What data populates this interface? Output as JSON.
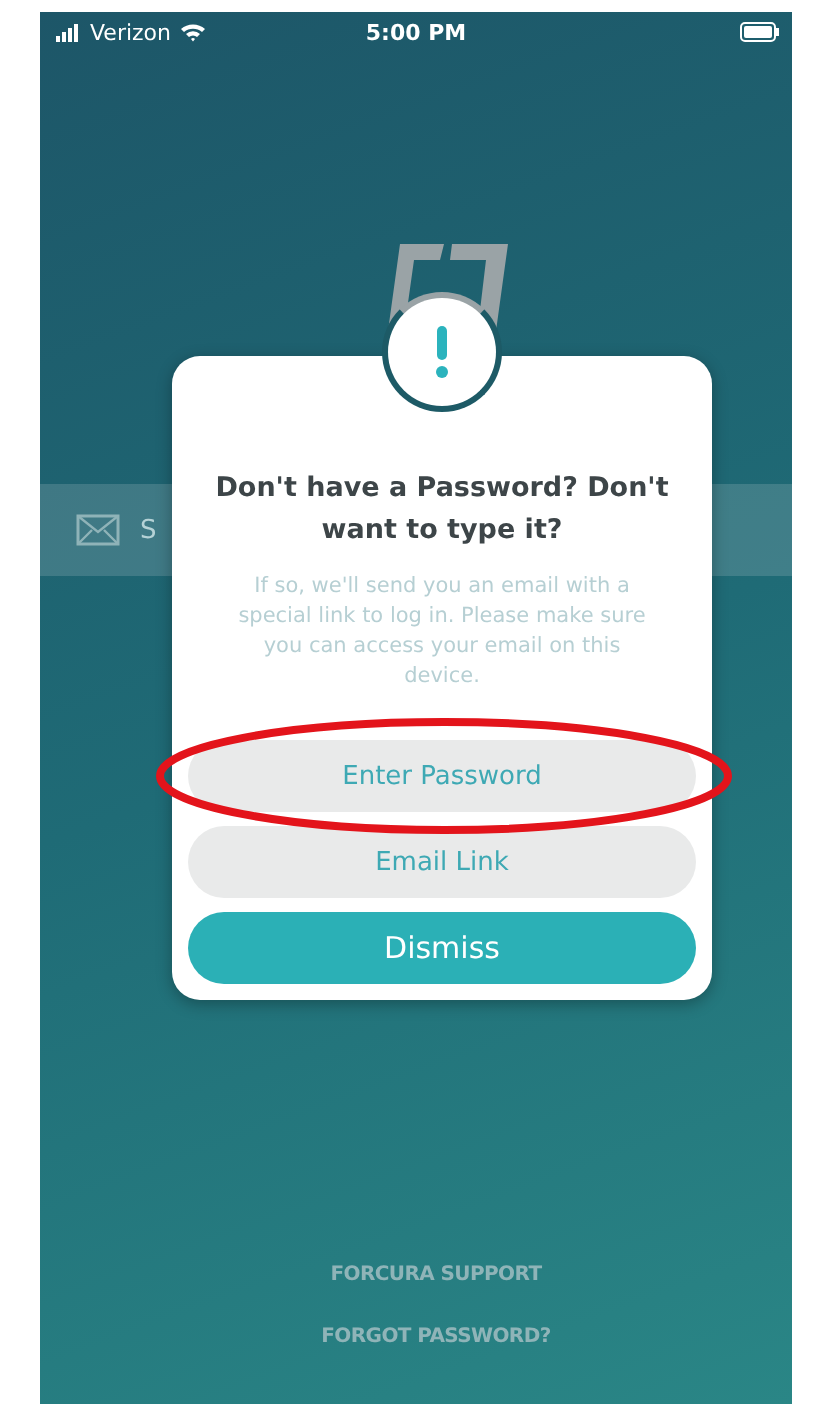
{
  "status_bar": {
    "carrier": "Verizon",
    "time": "5:00 PM"
  },
  "email_field": {
    "placeholder": "S"
  },
  "dialog": {
    "title": "Don't have a Password? Don't want to type it?",
    "message": "If so, we'll send you an email with a special link to log in. Please make sure you can access your email on this device.",
    "buttons": [
      {
        "label": "Enter Password",
        "kind": "secondary"
      },
      {
        "label": "Email Link",
        "kind": "secondary"
      },
      {
        "label": "Dismiss",
        "kind": "primary"
      }
    ]
  },
  "links": [
    "FORCURA SUPPORT",
    "FORGOT PASSWORD?"
  ]
}
